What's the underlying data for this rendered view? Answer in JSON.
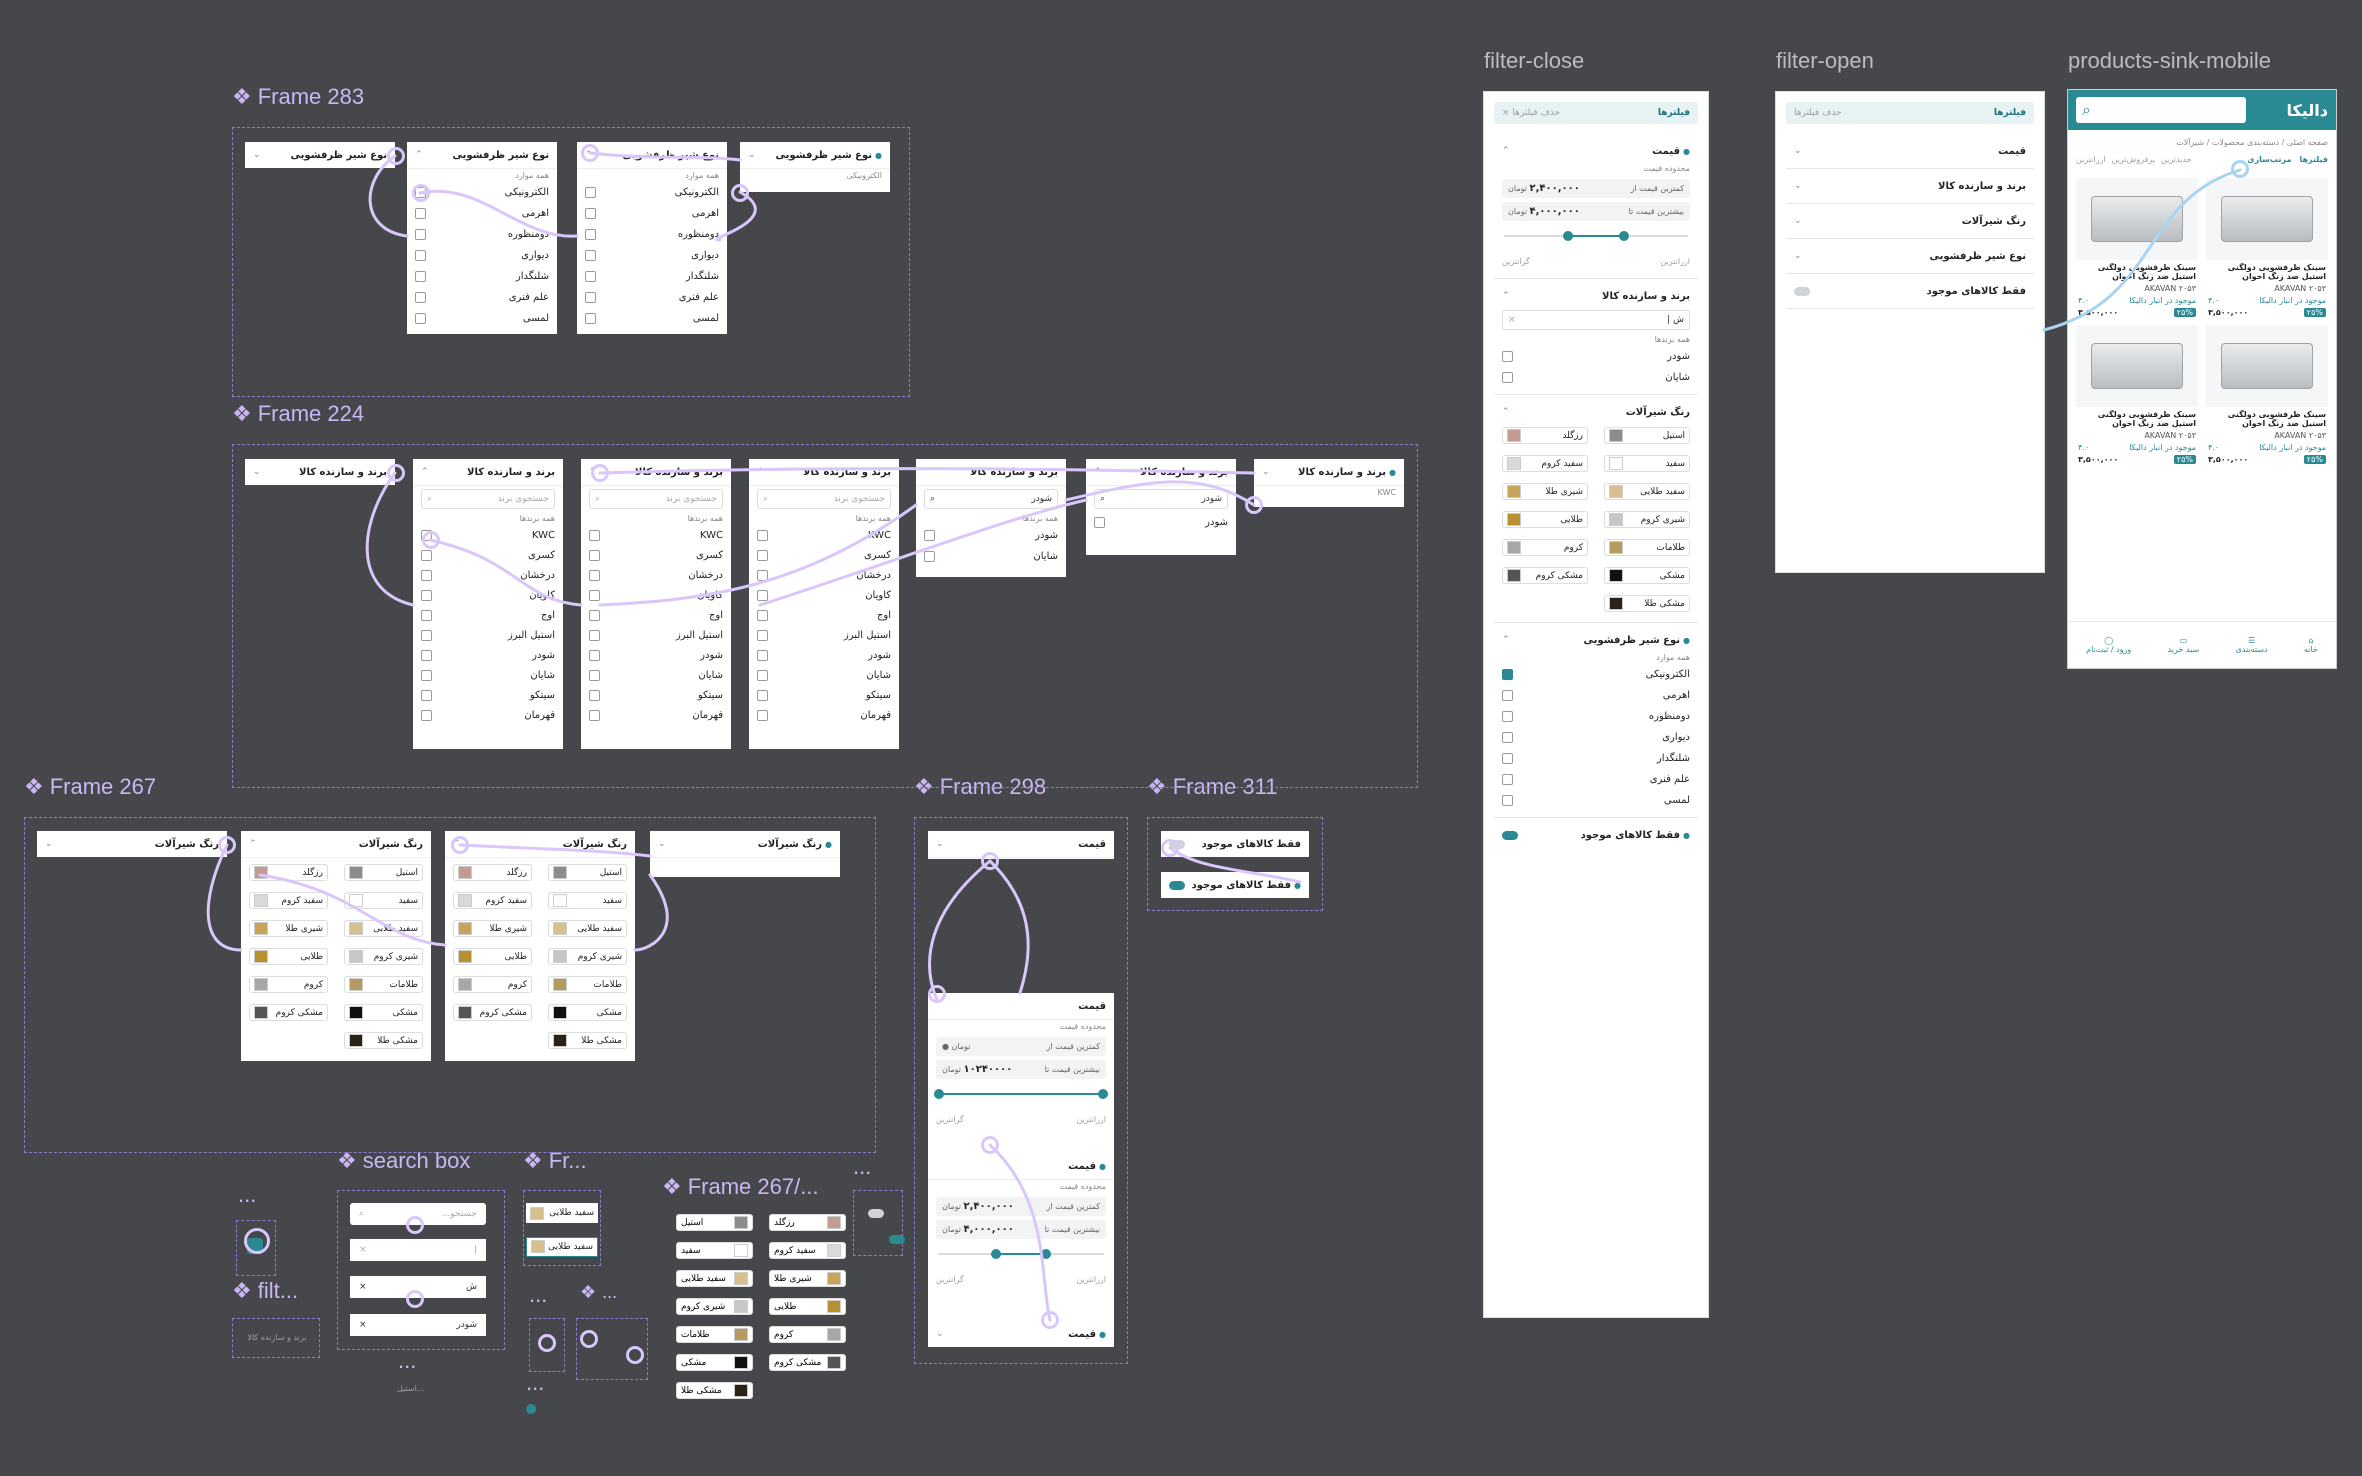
{
  "frames": {
    "f283": "Frame 283",
    "f224": "Frame 224",
    "f267": "Frame 267",
    "f298": "Frame 298",
    "f311": "Frame 311",
    "search_box": "search box",
    "fr": "Fr...",
    "filt": "filt...",
    "f267b": "Frame 267/...",
    "ellipsis": "...",
    "filter_close": "filter-close",
    "filter_open": "filter-open",
    "products_mobile": "products-sink-mobile"
  },
  "faucet_type": {
    "title": "نوع شیر ظرفشویی",
    "all": "همه موارد",
    "options": [
      "الکترونیکی",
      "اهرمی",
      "دومنظوره",
      "دیواری",
      "شلنگدار",
      "علم فنری",
      "لمسی"
    ],
    "selected_hint": "الکترونیکی"
  },
  "brand": {
    "title": "برند و سازنده کالا",
    "search_placeholder": "جستجوی برند",
    "all": "همه برندها",
    "options": [
      "KWC",
      "کسری",
      "درخشان",
      "کاویان",
      "اوج",
      "استیل البرز",
      "شودر",
      "شایان",
      "سیتکو",
      "قهرمان"
    ],
    "filtered": [
      "شودر",
      "شایان"
    ],
    "query": "شودر",
    "hint": "KWC"
  },
  "color": {
    "title": "رنگ شیرآلات",
    "options": [
      {
        "label": "استیل",
        "color": "#8c8c8c"
      },
      {
        "label": "رزگلد",
        "color": "#c49a94"
      },
      {
        "label": "سفید",
        "color": "#ffffff"
      },
      {
        "label": "سفید کروم",
        "color": "#d9d9d9"
      },
      {
        "label": "سفید طلایی",
        "color": "#d6c08c"
      },
      {
        "label": "شیری طلا",
        "color": "#c8a45a"
      },
      {
        "label": "شیری کروم",
        "color": "#c7c7c7"
      },
      {
        "label": "طلایی",
        "color": "#b8902f"
      },
      {
        "label": "طلامات",
        "color": "#b59b62"
      },
      {
        "label": "کروم",
        "color": "#a7a7a7"
      },
      {
        "label": "مشکی",
        "color": "#111111"
      },
      {
        "label": "مشکی کروم",
        "color": "#555555"
      },
      {
        "label": "مشکی طلا",
        "color": "#2a2216"
      }
    ]
  },
  "price": {
    "title": "قیمت",
    "range_label": "محدوده قیمت",
    "min_label": "کمترین قیمت از",
    "max_label": "بیشترین قیمت تا",
    "currency": "تومان",
    "min_value": "۲,۴۰۰,۰۰۰",
    "max_value": "۴,۰۰۰,۰۰۰",
    "frame298_max": "۱۰۲۴۰۰۰۰",
    "cheapest": "ارزانترین",
    "most_expensive": "گرانترین",
    "slider_min_fraction": 0.35,
    "slider_max_fraction": 0.65
  },
  "available": {
    "title": "فقط کالاهای موجود"
  },
  "filter_panel": {
    "header": "فیلترها",
    "clear": "حذف فیلترها",
    "close_icon": "×"
  },
  "mobile": {
    "logo": "دالیکا",
    "breadcrumb": "صفحه اصلی / دسته‌بندی محصولات / شیرآلات",
    "filters": "فیلترها",
    "sort": "مرتب‌سازی",
    "tabs": [
      "جدیدترین",
      "پرفروش‌ترین",
      "ارزانترین"
    ],
    "product_title": "سینک ظرفشویی دولگنی استیل ضد زنگ اخوان",
    "product_code": "AKAVAN ۲۰۵۳",
    "product_price": "۳,۵۰۰,۰۰۰",
    "discount": "۲۵%",
    "rating": "۴.۰",
    "stock": "موجود در انبار دالیکا",
    "nav": [
      "خانه",
      "دسته‌بندی",
      "سبد خرید",
      "ورود / ثبت‌نام"
    ]
  },
  "minis": {
    "search_empty": "جستجو...",
    "search_query": "ش",
    "search_result": "شودر",
    "white_gold": "سفید طلایی",
    "brand_placeholder": "برند و سازنده کالا",
    "steel_hint": "استیل..."
  }
}
